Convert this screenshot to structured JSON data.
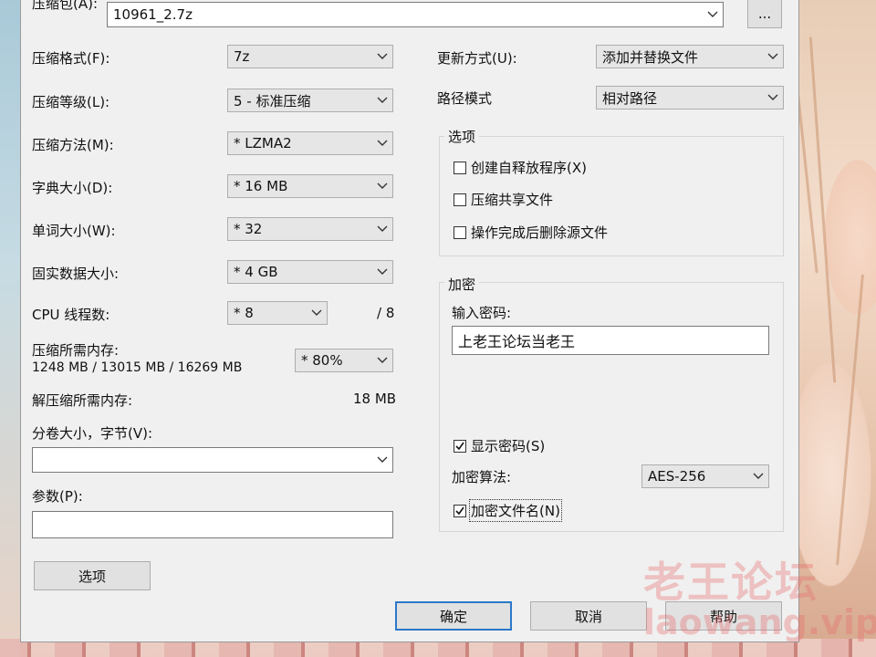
{
  "archive": {
    "label": "压缩包(A):",
    "path": "10961_2.7z",
    "browse_label": "..."
  },
  "left": {
    "format": {
      "label": "压缩格式(F):",
      "value": "7z"
    },
    "level": {
      "label": "压缩等级(L):",
      "value": "5 - 标准压缩"
    },
    "method": {
      "label": "压缩方法(M):",
      "value": "* LZMA2"
    },
    "dict": {
      "label": "字典大小(D):",
      "value": "* 16 MB"
    },
    "word": {
      "label": "单词大小(W):",
      "value": "* 32"
    },
    "solid": {
      "label": "固实数据大小:",
      "value": "* 4 GB"
    },
    "threads": {
      "label": "CPU 线程数:",
      "value": "* 8",
      "max": "/ 8"
    },
    "memory": {
      "label": "压缩所需内存:",
      "detail": "1248 MB / 13015 MB / 16269 MB",
      "value": "* 80%"
    },
    "decomp": {
      "label": "解压缩所需内存:",
      "value": "18 MB"
    },
    "split": {
      "label": "分卷大小，字节(V):",
      "value": ""
    },
    "params": {
      "label": "参数(P):",
      "value": ""
    },
    "options_button": "选项"
  },
  "right": {
    "update": {
      "label": "更新方式(U):",
      "value": "添加并替换文件"
    },
    "pathmode": {
      "label": "路径模式",
      "value": "相对路径"
    },
    "options": {
      "title": "选项",
      "sfx": {
        "label": "创建自释放程序(X)",
        "checked": false
      },
      "shared": {
        "label": "压缩共享文件",
        "checked": false
      },
      "delete": {
        "label": "操作完成后删除源文件",
        "checked": false
      }
    },
    "encryption": {
      "title": "加密",
      "password_label": "输入密码:",
      "password_value": "上老王论坛当老王",
      "show_password": {
        "label": "显示密码(S)",
        "checked": true
      },
      "method_label": "加密算法:",
      "method_value": "AES-256",
      "encrypt_names": {
        "label": "加密文件名(N)",
        "checked": true
      }
    }
  },
  "footer": {
    "ok": "确定",
    "cancel": "取消",
    "help": "帮助"
  },
  "watermark": {
    "cn": "老王论坛",
    "en": "laowang.vip"
  },
  "colors": {
    "accent": "#2b78c8",
    "dialog_bg": "#f0f0f0",
    "watermark": "#e86b6b"
  }
}
